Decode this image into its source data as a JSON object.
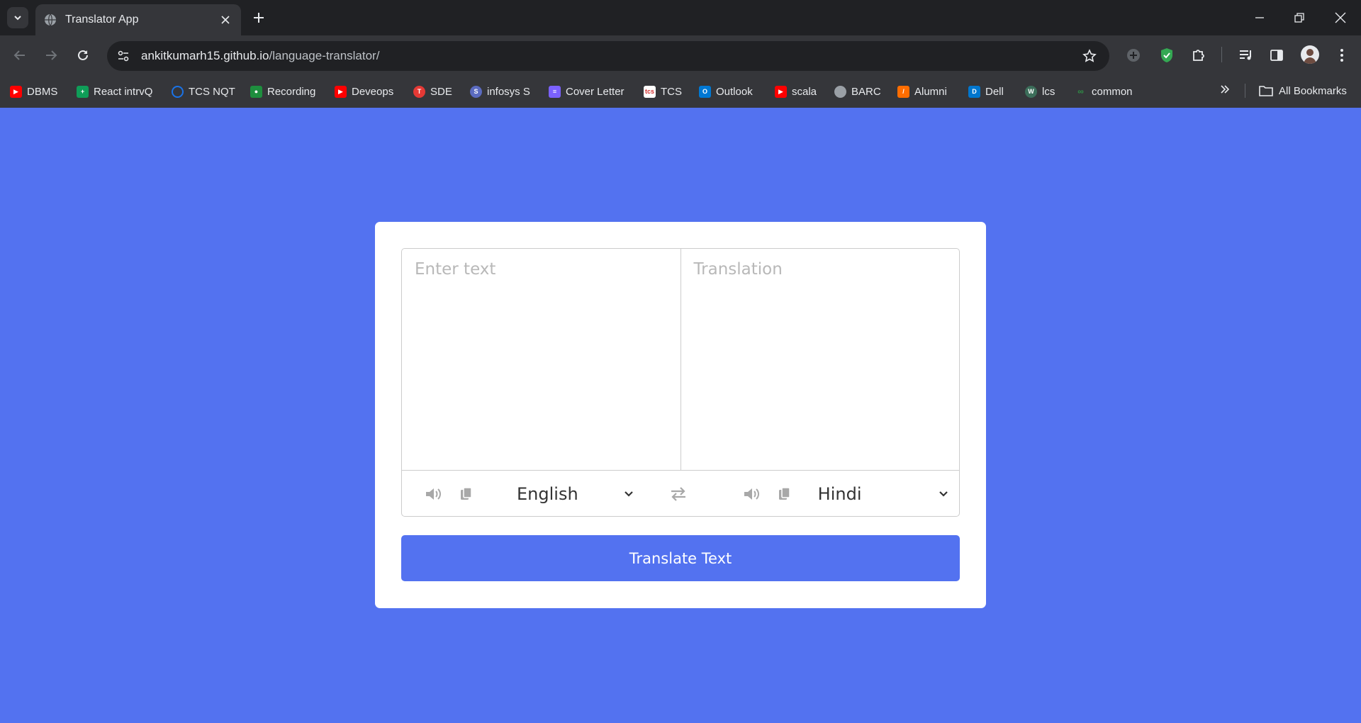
{
  "browser": {
    "tab_title": "Translator App",
    "url_host": "ankitkumarh15.github.io",
    "url_path": "/language-translator/",
    "bookmarks": [
      {
        "label": "DBMS",
        "icon": "youtube-icon",
        "color": "#ff0000"
      },
      {
        "label": "React intrvQ",
        "icon": "sheets-icon",
        "color": "#0f9d58"
      },
      {
        "label": "TCS NQT",
        "icon": "power-icon",
        "color": "#1a73e8"
      },
      {
        "label": "Recording",
        "icon": "classroom-icon",
        "color": "#1e8e3e"
      },
      {
        "label": "Deveops",
        "icon": "youtube-icon",
        "color": "#ff0000"
      },
      {
        "label": "SDE",
        "icon": "tuf-icon",
        "color": "#e53935"
      },
      {
        "label": "infosys S",
        "icon": "infosys-icon",
        "color": "#5b6bc0"
      },
      {
        "label": "Cover Letter",
        "icon": "docs-icon",
        "color": "#7b61ff"
      },
      {
        "label": "TCS",
        "icon": "tcs-icon",
        "color": "#ffffff"
      },
      {
        "label": "Outlook",
        "icon": "outlook-icon",
        "color": "#0078d4"
      },
      {
        "label": "scala",
        "icon": "youtube-icon",
        "color": "#ff0000"
      },
      {
        "label": "BARC",
        "icon": "globe-icon",
        "color": "#9aa0a6"
      },
      {
        "label": "Alumni",
        "icon": "alumni-icon",
        "color": "#ff6d00"
      },
      {
        "label": "Dell",
        "icon": "dell-icon",
        "color": "#0076ce"
      },
      {
        "label": "lcs",
        "icon": "wl-icon",
        "color": "#3c6e5a"
      },
      {
        "label": "common",
        "icon": "gfg-icon",
        "color": "#2f8d46"
      }
    ],
    "all_bookmarks_label": "All Bookmarks"
  },
  "translator": {
    "input_placeholder": "Enter text",
    "output_placeholder": "Translation",
    "from_language": "English",
    "to_language": "Hindi",
    "translate_button": "Translate Text"
  },
  "colors": {
    "page_bg": "#5372f0",
    "button_bg": "#5372f0"
  }
}
